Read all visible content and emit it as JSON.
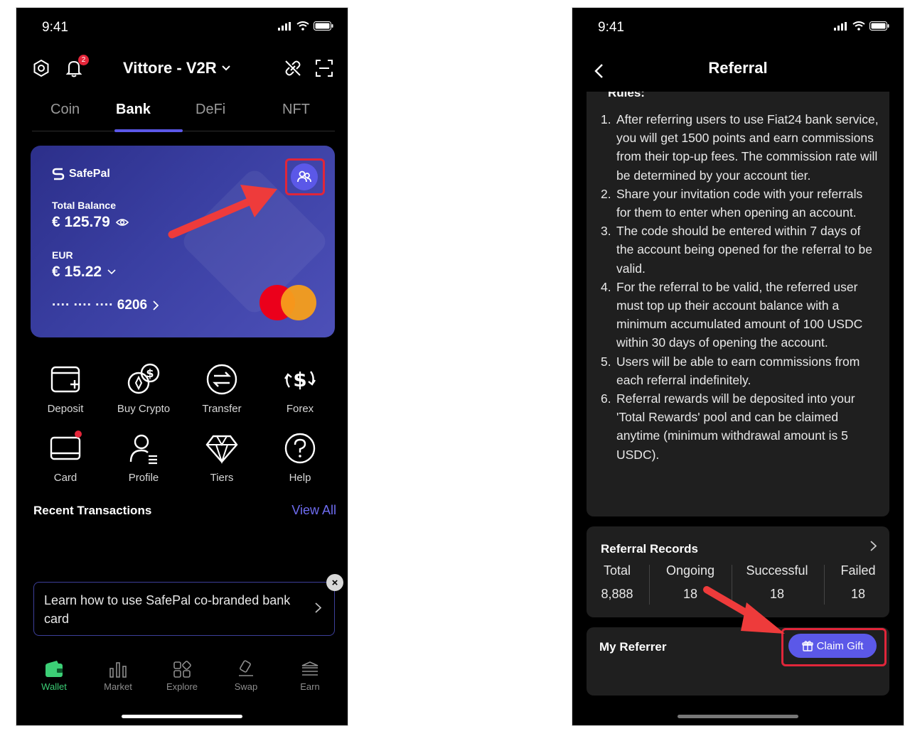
{
  "colors": {
    "accent": "#5b58e8",
    "highlight": "#e0263a",
    "active_nav": "#3ccf76",
    "card_gradient_start": "#2c2f8a",
    "card_gradient_end": "#4d50b8"
  },
  "left_screen": {
    "status_time": "9:41",
    "notification_count": "2",
    "wallet_name": "Vittore - V2R",
    "tabs": [
      {
        "label": "Coin",
        "active": false
      },
      {
        "label": "Bank",
        "active": true
      },
      {
        "label": "DeFi",
        "active": false
      },
      {
        "label": "NFT",
        "active": false
      }
    ],
    "card": {
      "brand": "SafePal",
      "total_balance_label": "Total Balance",
      "total_balance": "€ 125.79",
      "currency_label": "EUR",
      "currency_amount": "€ 15.22",
      "card_number": "···· ···· ···· 6206"
    },
    "actions": [
      {
        "label": "Deposit",
        "icon": "deposit-icon"
      },
      {
        "label": "Buy Crypto",
        "icon": "buy-crypto-icon"
      },
      {
        "label": "Transfer",
        "icon": "transfer-icon"
      },
      {
        "label": "Forex",
        "icon": "forex-icon"
      },
      {
        "label": "Card",
        "icon": "card-icon"
      },
      {
        "label": "Profile",
        "icon": "profile-icon"
      },
      {
        "label": "Tiers",
        "icon": "diamond-icon"
      },
      {
        "label": "Help",
        "icon": "help-icon"
      }
    ],
    "recent_transactions_title": "Recent Transactions",
    "view_all": "View All",
    "learn_banner": "Learn how to use SafePal co-branded bank card",
    "close_symbol": "×",
    "bottom_nav": [
      {
        "label": "Wallet",
        "active": true
      },
      {
        "label": "Market",
        "active": false
      },
      {
        "label": "Explore",
        "active": false
      },
      {
        "label": "Swap",
        "active": false
      },
      {
        "label": "Earn",
        "active": false
      }
    ]
  },
  "right_screen": {
    "status_time": "9:41",
    "title": "Referral",
    "rules_heading": "Rules:",
    "rules": [
      {
        "num": "1.",
        "text": "After referring users to use Fiat24 bank service, you will get 1500 points and earn commissions from their top-up fees. The commission rate will be determined by your account tier."
      },
      {
        "num": "2.",
        "text": "Share your invitation code with your referrals for them to enter when opening an account."
      },
      {
        "num": "3.",
        "text": "The code should be entered within 7 days of the account being opened for the referral to be valid."
      },
      {
        "num": "4.",
        "text": "For the referral to be valid, the referred user must top up their account balance with a minimum accumulated amount of 100 USDC within 30 days of opening the account."
      },
      {
        "num": "5.",
        "text": "Users will be able to earn commissions from each referral indefinitely."
      },
      {
        "num": "6.",
        "text": "Referral rewards will be deposited into your 'Total Rewards' pool and can be claimed anytime (minimum withdrawal amount is 5 USDC)."
      }
    ],
    "records": {
      "title": "Referral Records",
      "stats": [
        {
          "label": "Total",
          "value": "8,888"
        },
        {
          "label": "Ongoing",
          "value": "18"
        },
        {
          "label": "Successful",
          "value": "18"
        },
        {
          "label": "Failed",
          "value": "18"
        }
      ]
    },
    "referrer": {
      "title": "My Referrer",
      "claim_button": "Claim Gift"
    }
  }
}
